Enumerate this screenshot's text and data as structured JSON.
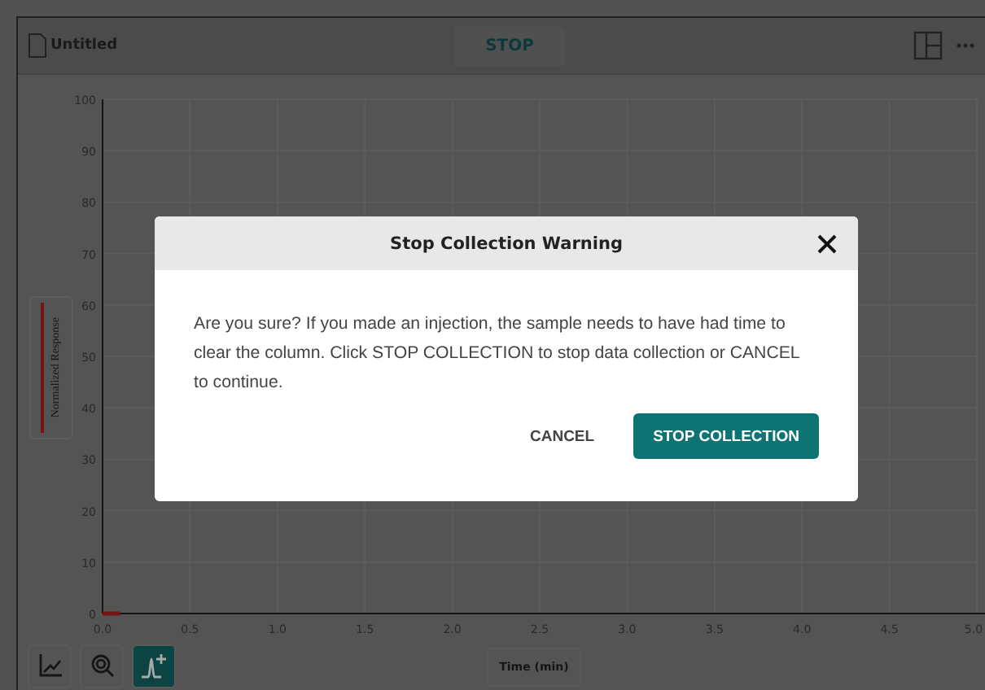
{
  "header": {
    "document_title": "Untitled",
    "stop_button": "STOP"
  },
  "chart": {
    "chart_data": {
      "type": "line",
      "grid": true,
      "xlabel": "Time (min)",
      "xlim": [
        0,
        5
      ],
      "ylim": [
        0,
        100
      ],
      "xticks": [
        {
          "value": 0,
          "label": "0.0"
        },
        {
          "value": 0.5,
          "label": "0.5"
        },
        {
          "value": 1,
          "label": "1.0"
        },
        {
          "value": 1.5,
          "label": "1.5"
        },
        {
          "value": 2,
          "label": "2.0"
        },
        {
          "value": 2.5,
          "label": "2.5"
        },
        {
          "value": 3,
          "label": "3.0"
        },
        {
          "value": 3.5,
          "label": "3.5"
        },
        {
          "value": 4,
          "label": "4.0"
        },
        {
          "value": 4.5,
          "label": "4.5"
        },
        {
          "value": 5,
          "label": "5.0"
        }
      ],
      "yticks": [
        0,
        10,
        20,
        30,
        40,
        50,
        60,
        70,
        80,
        90,
        100
      ],
      "x": [
        0,
        0.1
      ],
      "series": [
        {
          "name": "Normalized Response",
          "color": "#7a1414",
          "values": [
            0,
            0
          ]
        }
      ]
    }
  },
  "tools": [
    {
      "kind": "axes",
      "selected": false
    },
    {
      "kind": "zoom",
      "selected": false
    },
    {
      "kind": "peak",
      "selected": true
    }
  ],
  "dialog": {
    "title": "Stop Collection Warning",
    "message": "Are you sure? If you made an injection, the sample needs to have had time to clear the column. Click STOP COLLECTION to stop data collection or CANCEL to continue.",
    "cancel_button": "CANCEL",
    "confirm_button": "STOP COLLECTION"
  }
}
